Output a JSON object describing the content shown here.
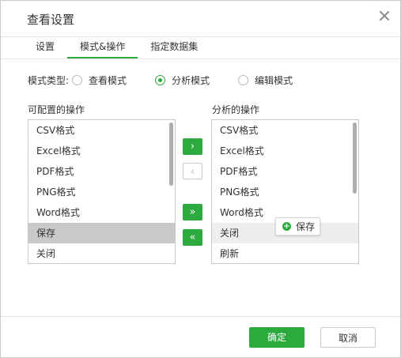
{
  "dialog": {
    "title": "查看设置"
  },
  "tabs": [
    {
      "label": "设置",
      "active": false
    },
    {
      "label": "模式&操作",
      "active": true
    },
    {
      "label": "指定数据集",
      "active": false
    }
  ],
  "mode": {
    "label": "模式类型:",
    "options": [
      "查看模式",
      "分析模式",
      "编辑模式"
    ],
    "selected": "分析模式"
  },
  "configurable": {
    "title": "可配置的操作",
    "items": [
      "CSV格式",
      "Excel格式",
      "PDF格式",
      "PNG格式",
      "Word格式",
      "保存",
      "关闭"
    ],
    "selected": "保存"
  },
  "analysis": {
    "title": "分析的操作",
    "items": [
      "CSV格式",
      "Excel格式",
      "PDF格式",
      "PNG格式",
      "Word格式",
      "关闭",
      "刷新"
    ],
    "hovered": "关闭"
  },
  "move_buttons": {
    "add": "›",
    "remove": "‹",
    "add_all": "»",
    "remove_all": "«"
  },
  "drag_tooltip": {
    "label": "保存",
    "icon": "plus-circle-icon"
  },
  "footer": {
    "ok_label": "确定",
    "cancel_label": "取消"
  },
  "colors": {
    "accent": "#2baa3e",
    "selected_row": "#c9c9c9"
  }
}
